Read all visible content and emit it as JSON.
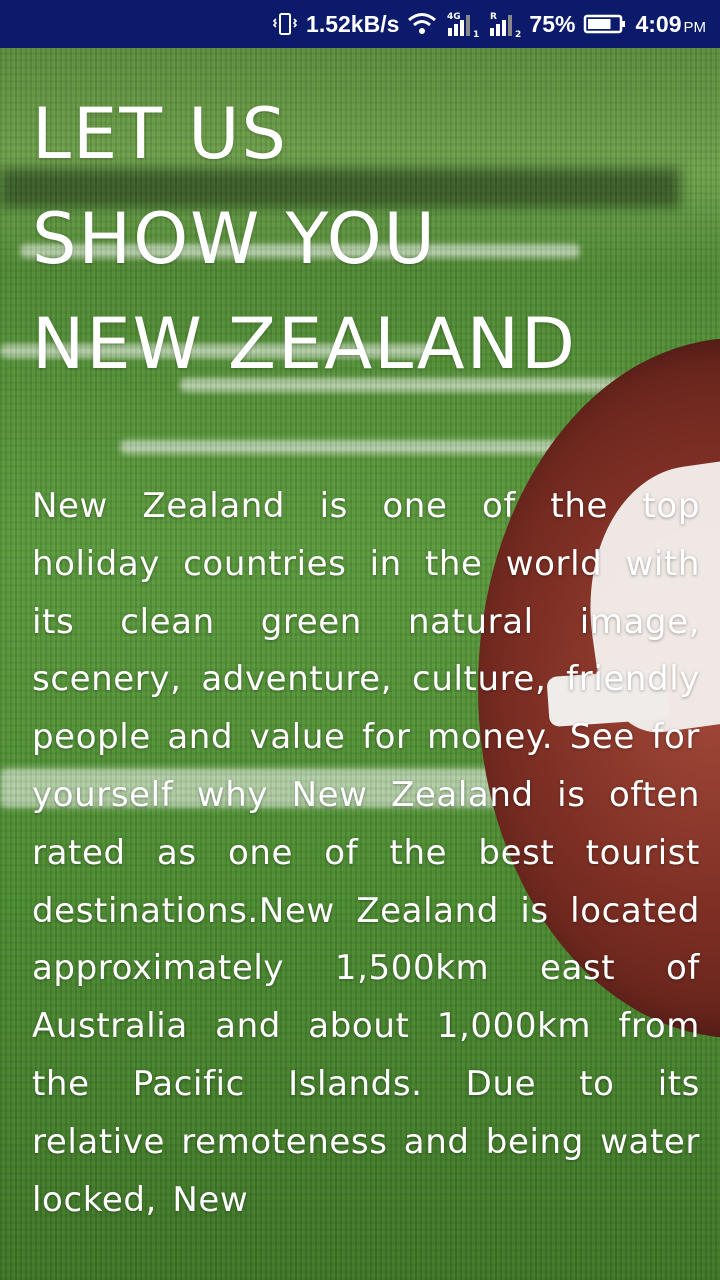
{
  "status_bar": {
    "network_speed": "1.52kB/s",
    "signal_1_label": "4G",
    "signal_1_sub": "1",
    "signal_2_label": "R",
    "signal_2_sub": "2",
    "battery_percent": "75%",
    "battery_level": 0.75,
    "time": "4:09",
    "time_suffix": "PM"
  },
  "headline": {
    "line1": "LET US",
    "line2": "SHOW YOU",
    "line3": "NEW ZEALAND"
  },
  "body_text": "New Zealand is one of the top holiday countries in the world with its clean green natural image, scenery, adventure, culture, friendly people and value for money. See for yourself why New Zealand is often rated as one of the best tourist destinations.New Zealand is located approximately 1,500km east of Australia and about 1,000km from the Pacific Islands. Due to its relative remoteness and being water locked, New"
}
